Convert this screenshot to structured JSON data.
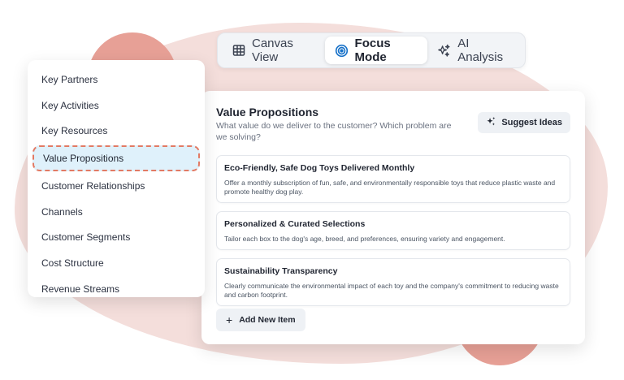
{
  "modes": [
    {
      "label": "Canvas View",
      "icon": "grid-icon",
      "active": false
    },
    {
      "label": "Focus Mode",
      "icon": "target-icon",
      "active": true
    },
    {
      "label": "AI Analysis",
      "icon": "sparkles-icon",
      "active": false
    }
  ],
  "sidebar": {
    "items": [
      {
        "label": "Key Partners"
      },
      {
        "label": "Key Activities"
      },
      {
        "label": "Key Resources"
      },
      {
        "label": "Value Propositions",
        "active": true
      },
      {
        "label": "Customer Relationships"
      },
      {
        "label": "Channels"
      },
      {
        "label": "Customer Segments"
      },
      {
        "label": "Cost Structure"
      },
      {
        "label": "Revenue Streams"
      }
    ]
  },
  "panel": {
    "title": "Value Propositions",
    "subtitle": "What value do we deliver to the customer? Which problem are we solving?",
    "suggest_label": "Suggest Ideas",
    "cards": [
      {
        "title": "Eco-Friendly, Safe Dog Toys Delivered Monthly",
        "desc": "Offer a monthly subscription of fun, safe, and environmentally responsible toys that reduce plastic waste and promote healthy dog play."
      },
      {
        "title": "Personalized & Curated Selections",
        "desc": "Tailor each box to the dog's age, breed, and preferences, ensuring variety and engagement."
      },
      {
        "title": "Sustainability Transparency",
        "desc": "Clearly communicate the environmental impact of each toy and the company's commitment to reducing waste and carbon footprint."
      }
    ],
    "add_label": "Add New Item"
  },
  "colors": {
    "accent_dashed": "#e27a64",
    "active_bg": "#dff1fb",
    "blob": "#f4dedb",
    "blob_circle": "#e7a096"
  }
}
